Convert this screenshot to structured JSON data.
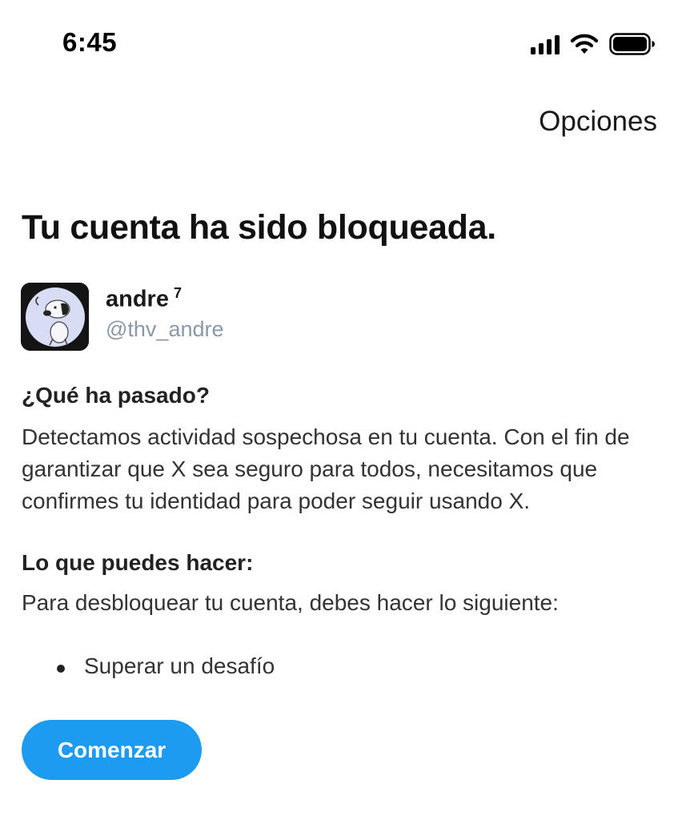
{
  "status_bar": {
    "time": "6:45",
    "icons": [
      "signal-icon",
      "wifi-icon",
      "battery-icon"
    ]
  },
  "header": {
    "options_label": "Opciones"
  },
  "page": {
    "title": "Tu cuenta ha sido bloqueada."
  },
  "account": {
    "display_name": "andre",
    "badge": "7",
    "handle": "@thv_andre",
    "avatar_icon": "snoopy-avatar-icon"
  },
  "what_happened": {
    "heading": "¿Qué ha pasado?",
    "body": "Detectamos actividad sospechosa en tu cuenta. Con el fin de garantizar que X sea seguro para todos, necesitamos que confirmes tu identidad para poder seguir usando X."
  },
  "what_you_can_do": {
    "heading": "Lo que puedes hacer:",
    "body": "Para desbloquear tu cuenta, debes hacer lo siguiente:",
    "steps": [
      "Superar un desafío"
    ]
  },
  "actions": {
    "start_label": "Comenzar"
  },
  "colors": {
    "accent": "#1d9bf0",
    "handle": "#8b98a5",
    "text": "#1a1a1a"
  }
}
